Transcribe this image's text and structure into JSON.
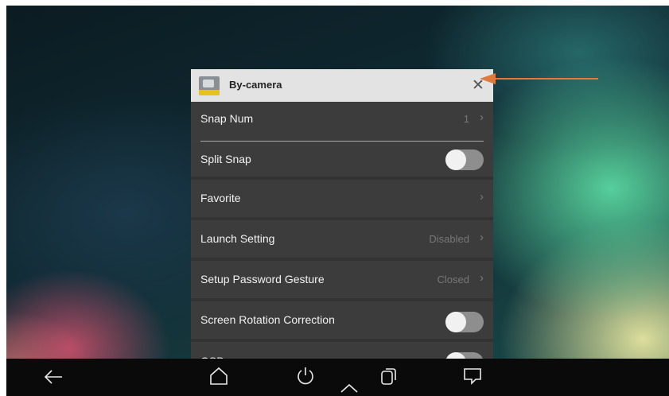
{
  "dialog": {
    "title": "By-camera",
    "close_glyph": "✕",
    "app_icon": "by-camera-app-icon"
  },
  "settings": [
    {
      "label": "Snap Num",
      "value": "1",
      "control": "chevron"
    },
    {
      "label": "Split Snap",
      "value": "",
      "control": "toggle",
      "on": false
    },
    {
      "label": "Favorite",
      "value": "",
      "control": "chevron"
    },
    {
      "label": "Launch Setting",
      "value": "Disabled",
      "control": "chevron"
    },
    {
      "label": "Setup Password Gesture",
      "value": "Closed",
      "control": "chevron"
    },
    {
      "label": "Screen Rotation Correction",
      "value": "",
      "control": "toggle",
      "on": false
    },
    {
      "label": "OSD",
      "value": "",
      "control": "toggle",
      "on": false
    }
  ],
  "navbar": {
    "items": [
      "back-icon",
      "home-icon",
      "power-icon",
      "up-chevron-icon",
      "recent-apps-icon",
      "message-icon"
    ]
  },
  "annotation": {
    "arrow_color": "#e07a3b"
  },
  "colors": {
    "dialog_bg": "#3d3d3d",
    "titlebar_bg": "#e3e3e3",
    "navbar_bg": "#0a0a0a"
  }
}
